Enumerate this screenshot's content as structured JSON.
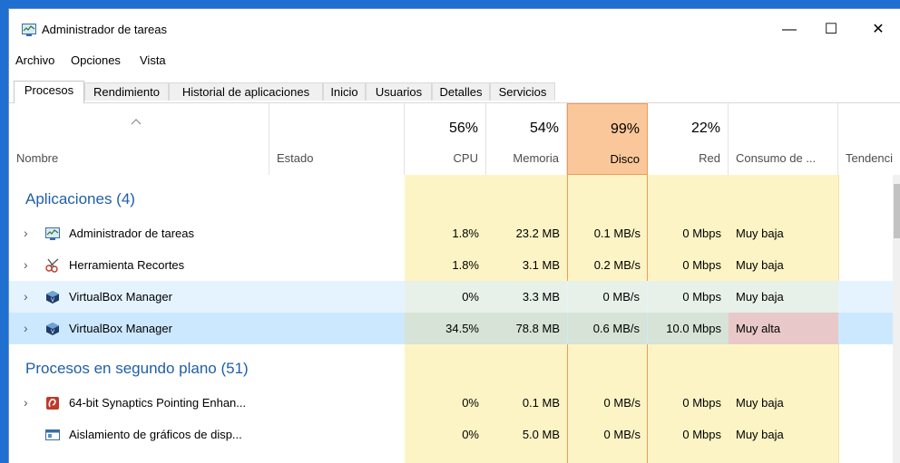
{
  "window": {
    "title": "Administrador de tareas",
    "controls": [
      "—",
      "☐",
      "✕"
    ]
  },
  "menu": [
    "Archivo",
    "Opciones",
    "Vista"
  ],
  "tabs": [
    "Procesos",
    "Rendimiento",
    "Historial de aplicaciones",
    "Inicio",
    "Usuarios",
    "Detalles",
    "Servicios"
  ],
  "columns": {
    "name": "Nombre",
    "status": "Estado",
    "cpu": {
      "pct": "56%",
      "label": "CPU"
    },
    "memory": {
      "pct": "54%",
      "label": "Memoria"
    },
    "disk": {
      "pct": "99%",
      "label": "Disco"
    },
    "network": {
      "pct": "22%",
      "label": "Red"
    },
    "power": "Consumo de ...",
    "trend": "Tendenci"
  },
  "groups": {
    "apps": "Aplicaciones (4)",
    "background": "Procesos en segundo plano (51)"
  },
  "rows": [
    {
      "name": "Administrador de tareas",
      "cpu": "1.8%",
      "mem": "23.2 MB",
      "disk": "0.1 MB/s",
      "net": "0 Mbps",
      "power": "Muy baja"
    },
    {
      "name": "Herramienta Recortes",
      "cpu": "1.8%",
      "mem": "3.1 MB",
      "disk": "0.2 MB/s",
      "net": "0 Mbps",
      "power": "Muy baja"
    },
    {
      "name": "VirtualBox Manager",
      "cpu": "0%",
      "mem": "3.3 MB",
      "disk": "0 MB/s",
      "net": "0 Mbps",
      "power": "Muy baja"
    },
    {
      "name": "VirtualBox Manager",
      "cpu": "34.5%",
      "mem": "78.8 MB",
      "disk": "0.6 MB/s",
      "net": "10.0 Mbps",
      "power": "Muy alta"
    },
    {
      "name": "64-bit Synaptics Pointing Enhan...",
      "cpu": "0%",
      "mem": "0.1 MB",
      "disk": "0 MB/s",
      "net": "0 Mbps",
      "power": "Muy baja"
    },
    {
      "name": "Aislamiento de gráficos de disp...",
      "cpu": "0%",
      "mem": "5.0 MB",
      "disk": "0 MB/s",
      "net": "0 Mbps",
      "power": "Muy baja"
    }
  ],
  "colors": {
    "disk_header": "#fac79a",
    "cell_yellow": "#fdf4c5",
    "selected_row": "#cce8ff",
    "hover_row": "#e5f3ff",
    "very_high": "#e8c8c8"
  }
}
